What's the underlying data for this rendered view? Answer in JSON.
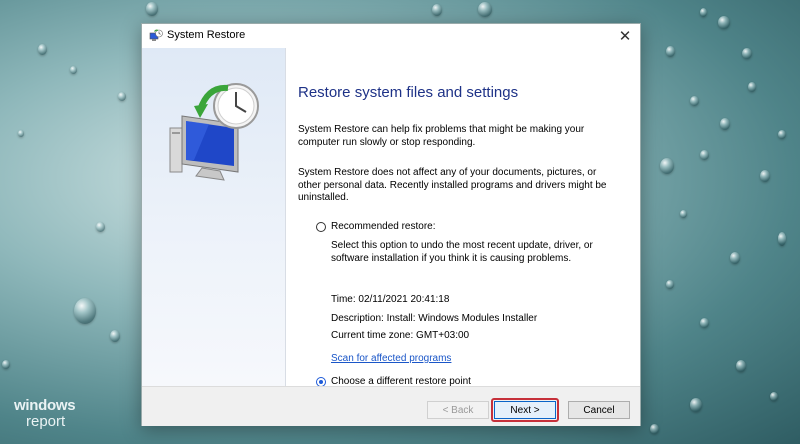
{
  "window": {
    "title": "System Restore",
    "close_glyph": "✕"
  },
  "content": {
    "heading": "Restore system files and settings",
    "para1": "System Restore can help fix problems that might be making your computer run slowly or stop responding.",
    "para2": "System Restore does not affect any of your documents, pictures, or other personal data. Recently installed programs and drivers might be uninstalled.",
    "recommended": {
      "label": "Recommended restore:",
      "description": "Select this option to undo the most recent update, driver, or software installation if you think it is causing problems.",
      "selected": false
    },
    "details": {
      "time": "Time: 02/11/2021 20:41:18",
      "description": "Description: Install: Windows Modules Installer",
      "timezone": "Current time zone: GMT+03:00"
    },
    "scan_link": "Scan for affected programs",
    "different": {
      "label": "Choose a different restore point",
      "selected": true
    }
  },
  "footer": {
    "back": "< Back",
    "next": "Next >",
    "cancel": "Cancel"
  },
  "watermark": {
    "line1": "windows",
    "line2": "report"
  },
  "colors": {
    "heading": "#1e3287",
    "link": "#1a56c8",
    "highlight": "#c6303a"
  }
}
